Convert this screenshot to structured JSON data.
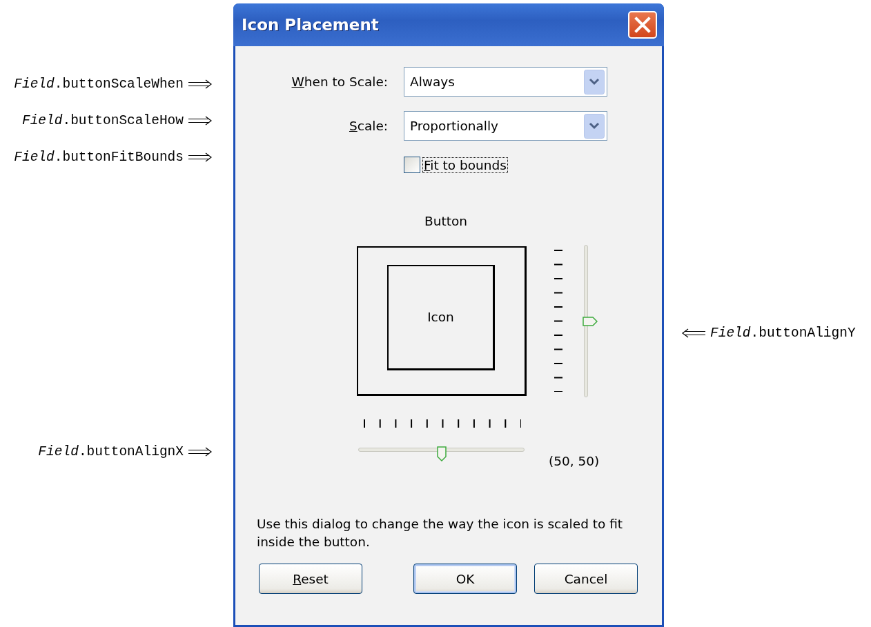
{
  "left_annotations": [
    {
      "text": "*Field*.buttonScaleWhen"
    },
    {
      "text": "*Field*.buttonScaleHow"
    },
    {
      "text": "*Field*.buttonFitBounds"
    },
    {
      "text": "*Field*.buttonAlignX"
    }
  ],
  "right_annotations": [
    {
      "text": "*Field*.buttonAlignY"
    }
  ],
  "window": {
    "title": "Icon Placement"
  },
  "fields": [
    {
      "label": "When to Scale:",
      "mnemonic": true,
      "value": "Always"
    },
    {
      "label": "Scale:",
      "mnemonic": true,
      "value": "Proportionally"
    }
  ],
  "checkbox": {
    "label": "Fit to bounds",
    "mnemonic": true,
    "checked": false,
    "focused": true
  },
  "preview": {
    "caption": "Button",
    "icon_label": "Icon"
  },
  "vertical_slider": {
    "level": 0.5
  },
  "horizontal_slider": {
    "level": 0.5
  },
  "reading": "(50, 50)",
  "description": "Use this dialog to change the way the icon is scaled to fit inside the button.",
  "buttons": [
    {
      "label": "Reset",
      "mnemonic": true,
      "default": false
    },
    {
      "label": "OK",
      "mnemonic": false,
      "default": true
    },
    {
      "label": "Cancel",
      "mnemonic": false,
      "default": false
    }
  ]
}
